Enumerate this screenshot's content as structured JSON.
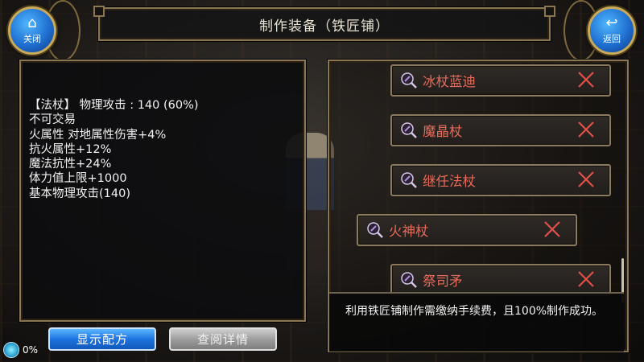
{
  "header": {
    "title": "制作装备（铁匠铺）",
    "close_label": "关闭",
    "back_label": "返回"
  },
  "item_info": {
    "lines": [
      "【法杖】 物理攻击 :  140 (60%)",
      "不可交易",
      "火属性 对地属性伤害+4%",
      "抗火属性+12%",
      "魔法抗性+24%",
      "体力值上限+1000",
      "基本物理攻击(140)"
    ]
  },
  "buttons": {
    "show_recipe": "显示配方",
    "view_details": "查阅详情"
  },
  "status": {
    "percent": "0%"
  },
  "recipes": [
    {
      "name": "冰杖蓝迪",
      "selected": false
    },
    {
      "name": "魔晶杖",
      "selected": false
    },
    {
      "name": "继任法杖",
      "selected": false
    },
    {
      "name": "火神杖",
      "selected": true
    },
    {
      "name": "祭司矛",
      "selected": false
    }
  ],
  "notice": {
    "text": "利用铁匠铺制作需缴纳手续费，且100%制作成功。"
  },
  "colors": {
    "recipe_name": "#e86a5a",
    "blue_button": "#1e74e0",
    "frame_gold": "#8a7650"
  }
}
